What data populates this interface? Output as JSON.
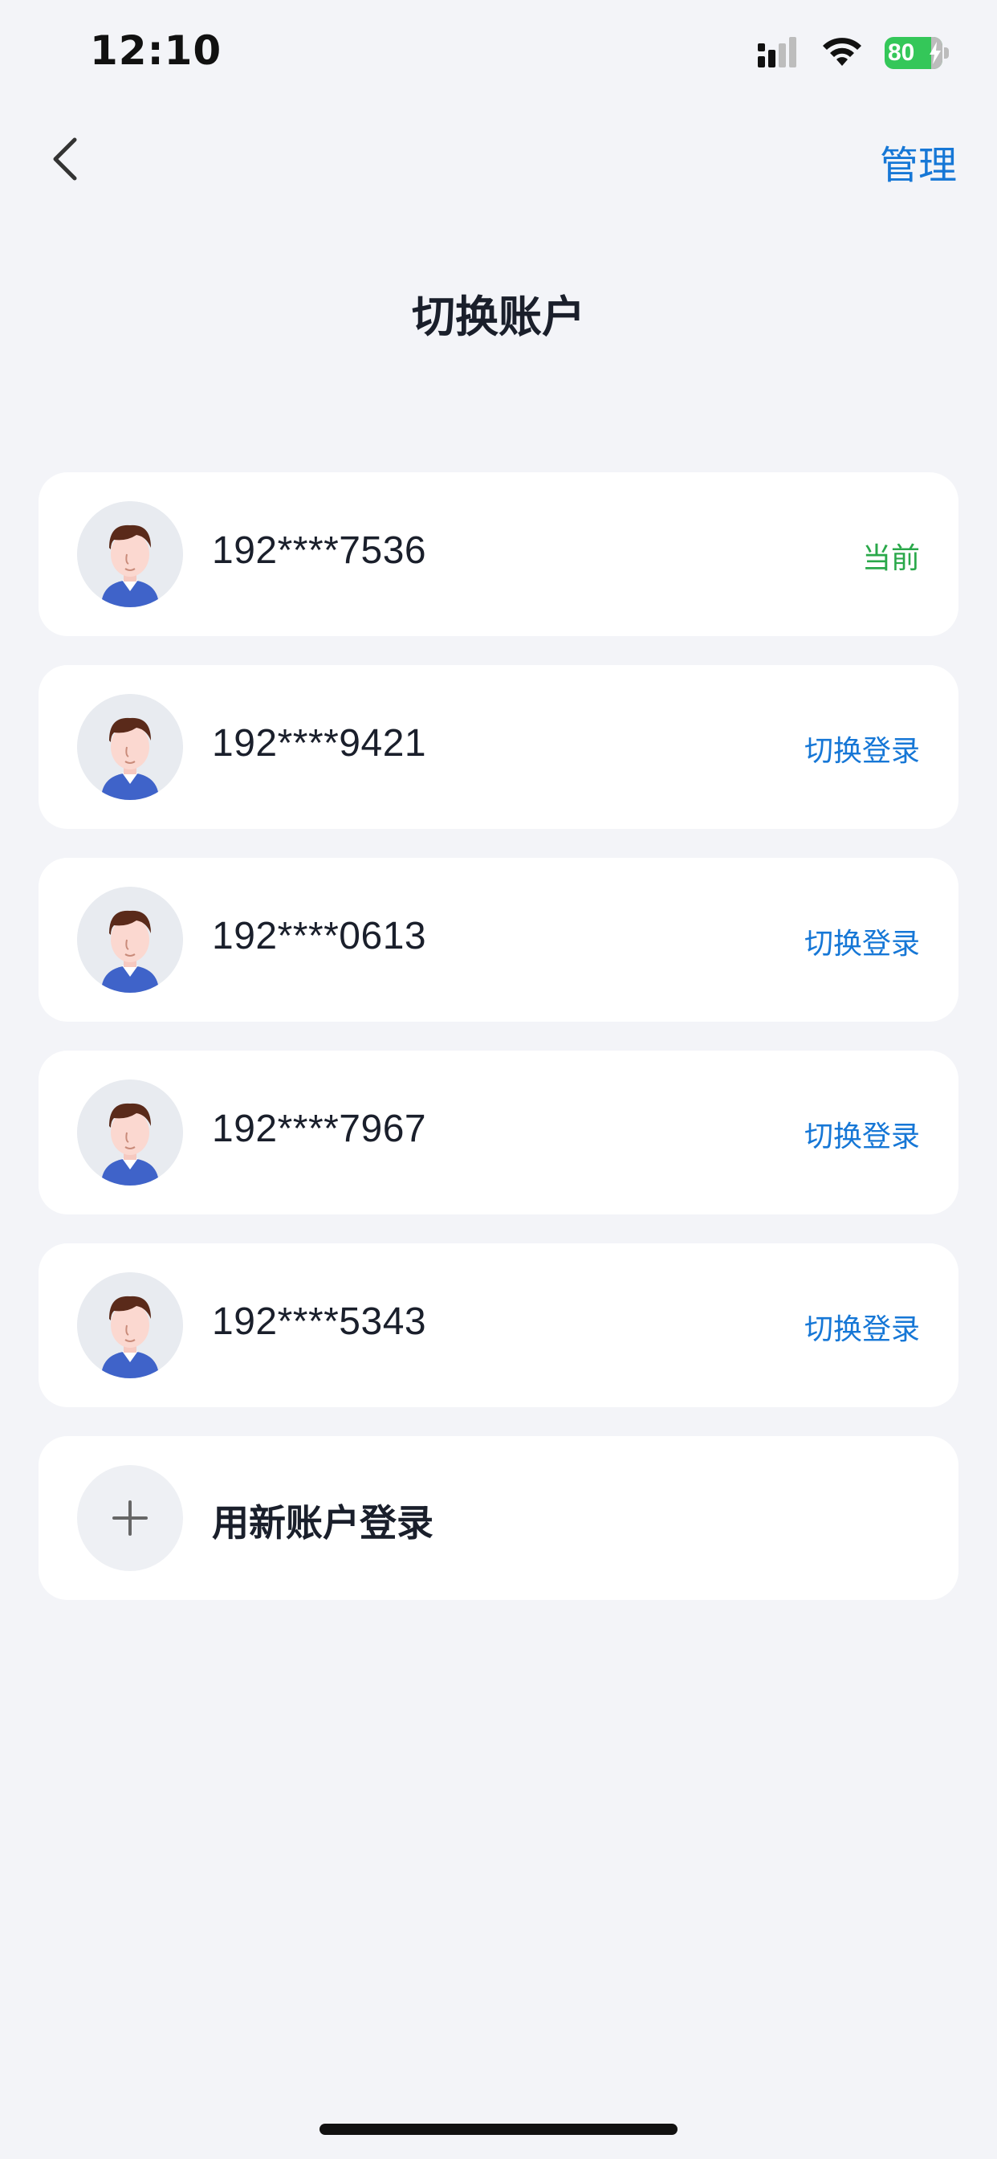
{
  "status_bar": {
    "time": "12:10",
    "battery": "80",
    "icons": [
      "signal-icon",
      "wifi-icon",
      "battery-icon"
    ],
    "battery_color": "#34c759"
  },
  "nav": {
    "back_icon": "chevron-left-icon",
    "manage_label": "管理"
  },
  "page_title": "切换账户",
  "accounts": [
    {
      "phone": "192****7536",
      "action": "当前",
      "is_current": true
    },
    {
      "phone": "192****9421",
      "action": "切换登录",
      "is_current": false
    },
    {
      "phone": "192****0613",
      "action": "切换登录",
      "is_current": false
    },
    {
      "phone": "192****7967",
      "action": "切换登录",
      "is_current": false
    },
    {
      "phone": "192****5343",
      "action": "切换登录",
      "is_current": false
    }
  ],
  "add_account": {
    "icon": "plus-icon",
    "label": "用新账户登录"
  },
  "colors": {
    "accent": "#1677d6",
    "current": "#2aa84a",
    "background": "#f3f4f8",
    "card": "#ffffff"
  }
}
